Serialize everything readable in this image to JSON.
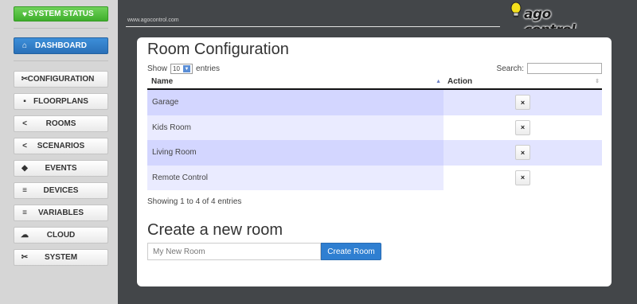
{
  "sidebar": {
    "status": {
      "label": "SYSTEM STATUS",
      "icon": "heart-icon"
    },
    "dashboard": {
      "label": "DASHBOARD",
      "icon": "home-icon"
    },
    "items": [
      {
        "label": "CONFIGURATION",
        "icon": "wrench-icon"
      },
      {
        "label": "FLOORPLANS",
        "icon": "grid-icon"
      },
      {
        "label": "ROOMS",
        "icon": "share-icon"
      },
      {
        "label": "SCENARIOS",
        "icon": "share-icon"
      },
      {
        "label": "EVENTS",
        "icon": "event-icon"
      },
      {
        "label": "DEVICES",
        "icon": "list-icon"
      },
      {
        "label": "VARIABLES",
        "icon": "list-icon"
      },
      {
        "label": "CLOUD",
        "icon": "cloud-icon"
      },
      {
        "label": "SYSTEM",
        "icon": "wrench-icon"
      }
    ]
  },
  "header": {
    "site_url": "www.agocontrol.com",
    "logo_text": "ago control"
  },
  "page": {
    "title": "Room Configuration",
    "show_label": "Show",
    "entries_value": "10",
    "entries_label": "entries",
    "search_label": "Search:",
    "columns": {
      "name": "Name",
      "action": "Action"
    },
    "rows": [
      {
        "name": "Garage",
        "action": "×"
      },
      {
        "name": "Kids Room",
        "action": "×"
      },
      {
        "name": "Living Room",
        "action": "×"
      },
      {
        "name": "Remote Control",
        "action": "×"
      }
    ],
    "showing": "Showing 1 to 4 of 4 entries",
    "create_title": "Create a new room",
    "new_room_placeholder": "My New Room",
    "create_button": "Create Room"
  },
  "colors": {
    "green": "#4cbb38",
    "blue": "#2f7fd1",
    "dark": "#434649",
    "row_highlight": "#d3d6ff"
  }
}
